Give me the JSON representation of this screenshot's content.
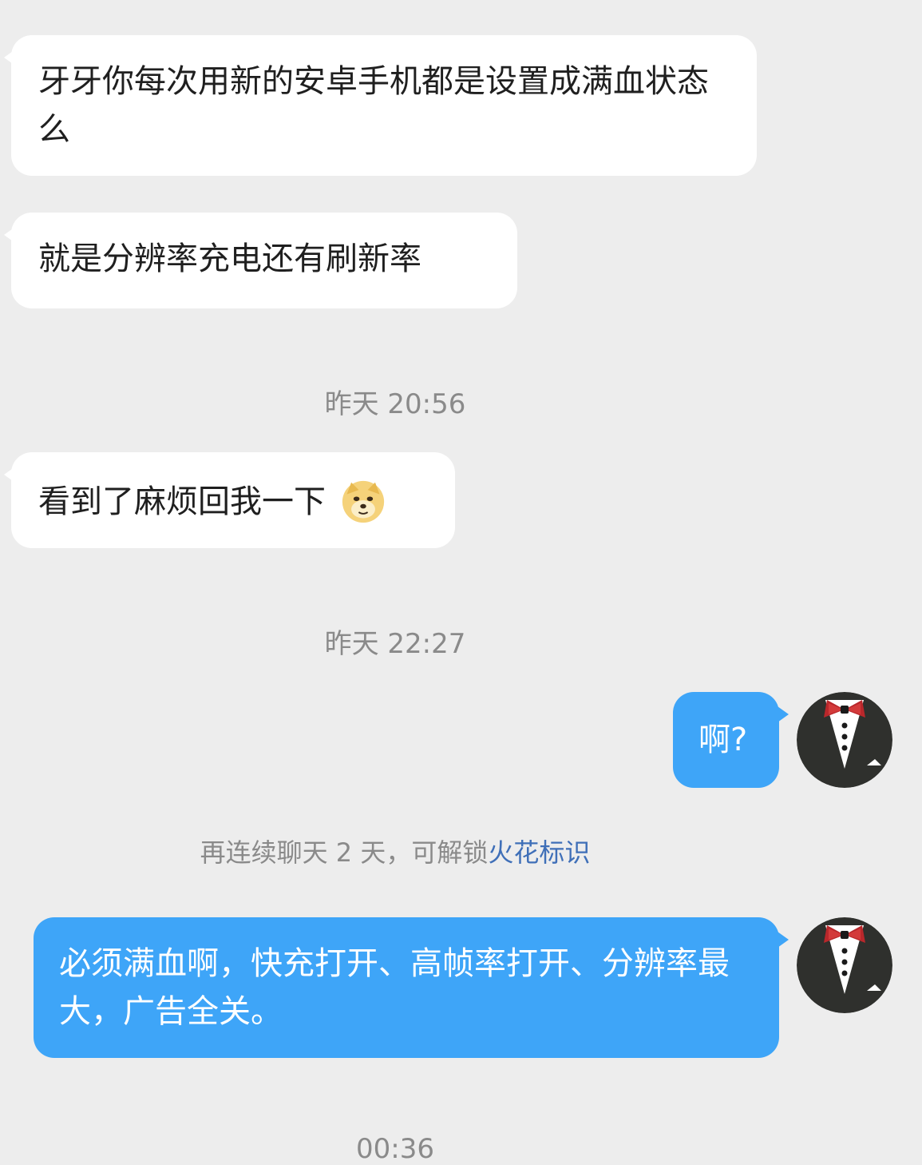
{
  "messages": [
    {
      "id": "m1",
      "side": "in",
      "text": "牙牙你每次用新的安卓手机都是设置成满血状态么"
    },
    {
      "id": "m2",
      "side": "in",
      "text": "就是分辨率充电还有刷新率"
    },
    {
      "id": "m3",
      "side": "in",
      "text": "看到了麻烦回我一下",
      "emoji": "doge-emoji-icon"
    },
    {
      "id": "m4",
      "side": "out",
      "text": "啊?"
    },
    {
      "id": "m5",
      "side": "out",
      "text": "必须满血啊，快充打开、高帧率打开、分辨率最大，广告全关。"
    }
  ],
  "timestamps": {
    "t1": "昨天 20:56",
    "t2": "昨天 22:27",
    "t3": "00:36"
  },
  "streak_hint": {
    "prefix": "再连续聊天 2 天，可解锁",
    "link": "火花标识"
  },
  "colors": {
    "background": "#ededed",
    "incoming_bubble": "#ffffff",
    "outgoing_bubble": "#3ea5f8",
    "link": "#3f6fb8"
  },
  "avatar_icon": "tuxedo-bowtie-avatar-icon"
}
